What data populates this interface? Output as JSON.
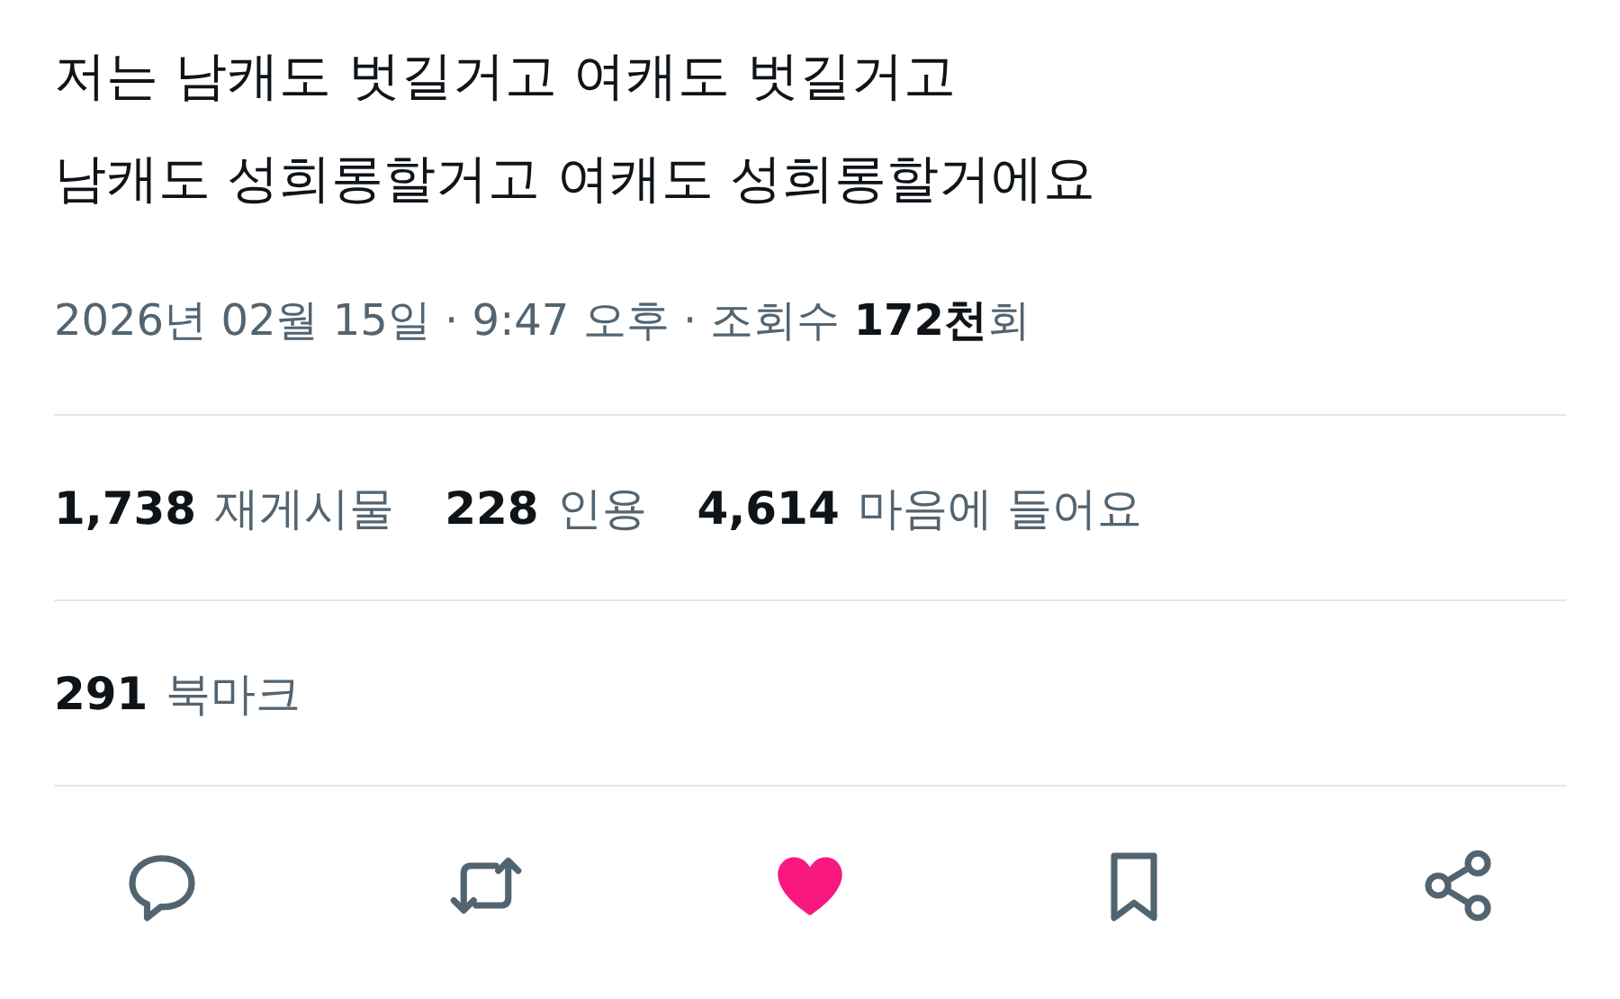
{
  "post": {
    "text_lines": [
      "저는 남캐도 벗길거고 여캐도 벗길거고",
      "남캐도 성희롱할거고 여캐도 성희롱할거에요"
    ],
    "meta": "2026년 02월 15일 · 9:47 오후 · 조회수 **172천**회"
  },
  "stats": [
    {
      "count": "1,738",
      "label": "재게시물"
    },
    {
      "count": "228",
      "label": "인용"
    },
    {
      "count": "4,614",
      "label": "마음에 들어요"
    }
  ],
  "bookmarks": {
    "count": "291",
    "label": "북마크"
  },
  "actions": [
    {
      "kind": "reply"
    },
    {
      "kind": "repost"
    },
    {
      "kind": "like",
      "selected": true
    },
    {
      "kind": "bookmark"
    },
    {
      "kind": "share"
    }
  ]
}
